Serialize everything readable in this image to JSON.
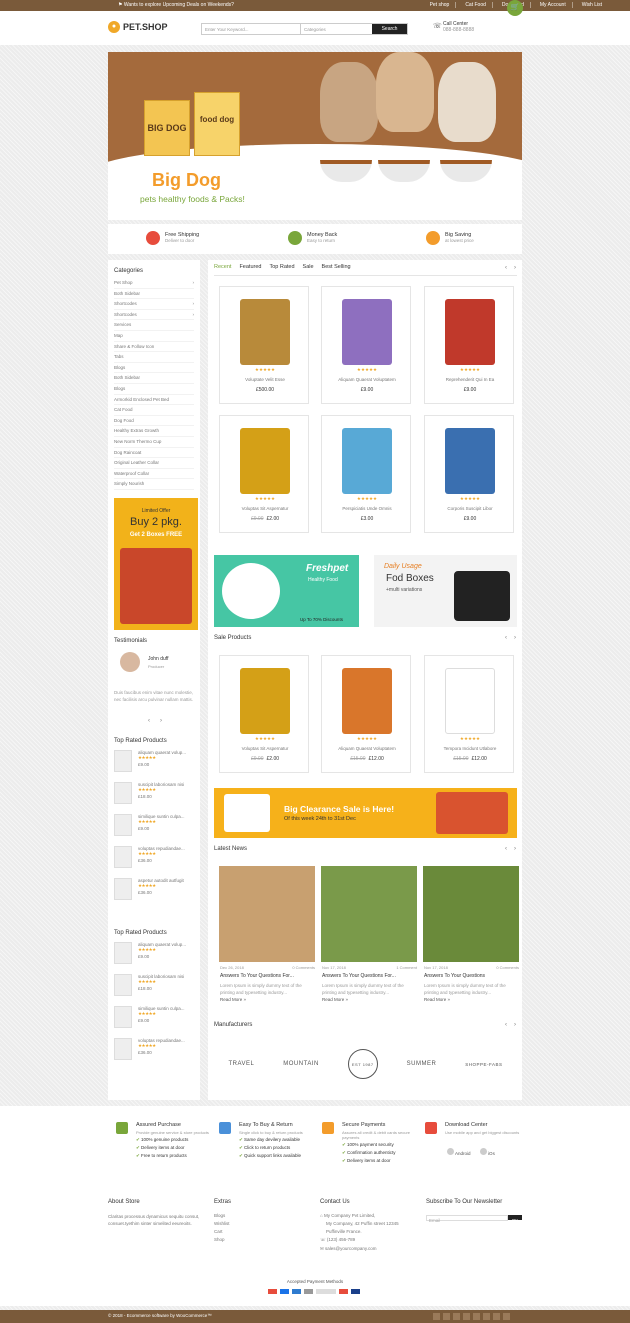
{
  "topbar": {
    "promo": "Wants to explore Upcoming Deals on Weekends?",
    "links": [
      "Pet shop",
      "Cat Food",
      "Dog Food",
      "My Account",
      "Wish List"
    ],
    "cart_count": "0"
  },
  "header": {
    "logo": "PET.SHOP",
    "search_placeholder": "Enter Your Keyword...",
    "category_label": "Categories",
    "search_btn": "Search",
    "call_title": "Call Center",
    "call_number": "088-888-8888"
  },
  "hero": {
    "title": "Big Dog",
    "subtitle": "pets healthy foods & Packs!",
    "box1": "BIG DOG",
    "box2": "food dog"
  },
  "features": [
    {
      "title": "Free Shipping",
      "sub": "Deliver to door"
    },
    {
      "title": "Money Back",
      "sub": "Easy to return"
    },
    {
      "title": "Big Saving",
      "sub": "at lowest price"
    }
  ],
  "sidebar": {
    "categories_title": "Categories",
    "categories": [
      "Pet Shop",
      "Both Sidebar",
      "Shortcodes",
      "Shortcodes",
      "Services",
      "Map",
      "Share & Follow Icon",
      "Tabs",
      "Blogs",
      "Both Sidebar",
      "Blogs",
      "Armorkid Enclosed Pet Bed",
      "Cat Food",
      "Dog Food",
      "Healthy Extras Growth",
      "New Norm Thermo Cup",
      "Dog Raincoat",
      "Original Leather Collar",
      "Waterproof Collar",
      "Simply Nourish"
    ],
    "offer": {
      "t1": "Limited Offer",
      "t2": "Buy 2 pkg.",
      "t3": "Get 2 Boxes FREE"
    },
    "testimonials_title": "Testimonials",
    "testimonial": {
      "name": "John duff",
      "role": "Producer",
      "text": "Duis faucibus enim vitae nunc molestie, nec facilisis arcu pulvinar nullam mattis."
    },
    "top_rated_title": "Top Rated Products",
    "top_rated": [
      {
        "name": "aliquam quaerat volup...",
        "price": "£9.00"
      },
      {
        "name": "suscipit laboriosam nisi",
        "price": "£18.00"
      },
      {
        "name": "similique suntin culpa...",
        "price": "£9.00"
      },
      {
        "name": "voluptas repudiandae...",
        "price": "£36.00"
      },
      {
        "name": "aspetur autodit autfugit",
        "price": "£36.00"
      }
    ],
    "top_rated2": [
      {
        "name": "aliquam quaerat volup...",
        "price": "£9.00"
      },
      {
        "name": "suscipit laboriosam nisi",
        "price": "£18.00"
      },
      {
        "name": "similique suntin culpa...",
        "price": "£9.00"
      },
      {
        "name": "voluptas repudiandae...",
        "price": "£36.00"
      }
    ]
  },
  "tabs": [
    "Recent",
    "Featured",
    "Top Rated",
    "Sale",
    "Best Selling"
  ],
  "products": [
    {
      "name": "Voluptate Velit Esse",
      "price": "£500.00",
      "old": ""
    },
    {
      "name": "Aliquam Quaerat Voluptatem",
      "price": "£9.00",
      "old": ""
    },
    {
      "name": "Reprehenderit Qui In Ea",
      "price": "£9.00",
      "old": ""
    },
    {
      "name": "Voluptas Sit Aspernatur",
      "price": "£2.00",
      "old": "£9.00"
    },
    {
      "name": "Perspiciatis Unde Omnis",
      "price": "£3.00",
      "old": ""
    },
    {
      "name": "Corporis Suscipit Libor",
      "price": "£9.00",
      "old": ""
    }
  ],
  "banner1": {
    "brand": "Freshpet",
    "sub": "Healthy Food",
    "badge": "Up To 70% Discounts"
  },
  "banner2": {
    "t1": "Daily Usage",
    "t2": "Fod Boxes",
    "t3": "+multi variations"
  },
  "sale_title": "Sale Products",
  "sale": [
    {
      "name": "Voluptas Sit Aspernatur",
      "price": "£2.00",
      "old": "£9.00"
    },
    {
      "name": "Aliquam Quaerat Voluptatem",
      "price": "£12.00",
      "old": "£15.00"
    },
    {
      "name": "Tempora Incidunt Utlabore",
      "price": "£12.00",
      "old": "£15.00"
    }
  ],
  "clearance": {
    "t1": "Big Clearance Sale is Here!",
    "t2": "Of this week 24th to 31st Dec"
  },
  "news_title": "Latest News",
  "news": [
    {
      "date": "Dec 26, 2018",
      "comments": "0 Comments",
      "title": "Answers To Your Questions For...",
      "text": "Lorem Ipsum is simply dummy text of the printing and typesetting industry...",
      "more": "Read More »"
    },
    {
      "date": "Nov 17, 2018",
      "comments": "1 Comment",
      "title": "Answers To Your Questions For...",
      "text": "Lorem Ipsum is simply dummy text of the printing and typesetting industry...",
      "more": "Read More »"
    },
    {
      "date": "Nov 17, 2018",
      "comments": "0 Comments",
      "title": "Answers To Your Questions",
      "text": "Lorem Ipsum is simply dummy text of the printing and typesetting industry...",
      "more": "Read More »"
    }
  ],
  "manufacturers_title": "Manufacturers",
  "manufacturers": [
    "TRAVEL",
    "MOUNTAIN",
    "EST 1987",
    "SUMMER",
    "SHOPPE-FABS"
  ],
  "footer": {
    "services": [
      {
        "title": "Assured Purchase",
        "sub": "Provide genuine service & store products",
        "items": [
          "100% genuine products",
          "Delivery items at door",
          "Free to return products"
        ]
      },
      {
        "title": "Easy To Buy & Return",
        "sub": "Single click to buy & return products",
        "items": [
          "Same day devilery available",
          "Click to return products",
          "Quick support links available"
        ]
      },
      {
        "title": "Secure Payments",
        "sub": "Assures all credit & debit cards secure payments",
        "items": [
          "100% payment security",
          "Confirmation authenticty",
          "Delivery items at door"
        ]
      },
      {
        "title": "Download Center",
        "sub": "Use mobile app and get biggest discounts",
        "items": []
      }
    ],
    "android": "Android",
    "ios": "iOs",
    "about_title": "About Store",
    "about_text": "Claritas processus dynamicus sequitu consut, consuet.tyethim sinter simelited eeureoits.",
    "extras_title": "Extras",
    "extras": [
      "Blogs",
      "Wishlist",
      "Cart",
      "Shop"
    ],
    "contact_title": "Contact Us",
    "contact": [
      "My Company Pvt Limited,",
      "My Company, 42 Puffin street 12345",
      "Puffinville France.",
      "(123) 456-789",
      "sales@yourcompany.com"
    ],
    "newsletter_title": "Subscribe To Our Newsletter",
    "email_placeholder": "Email",
    "ok": "OK",
    "payment_title": "Accepted Payment Methods",
    "copyright": "© 2018 - Ecommerce software by WooCommerce™"
  }
}
